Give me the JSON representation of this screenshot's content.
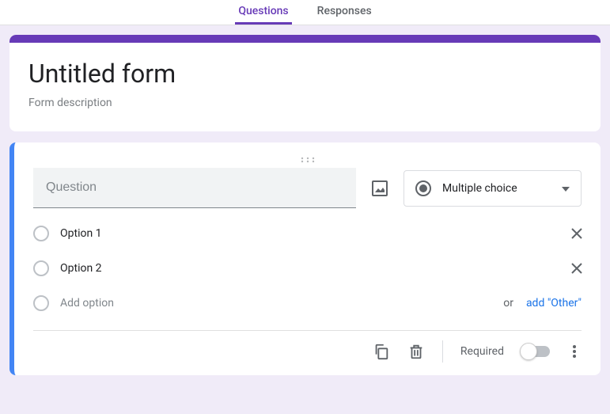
{
  "tabs": {
    "questions": "Questions",
    "responses": "Responses"
  },
  "header": {
    "title": "Untitled form",
    "description": "Form description"
  },
  "question": {
    "placeholder": "Question",
    "type_label": "Multiple choice",
    "options": [
      "Option 1",
      "Option 2"
    ],
    "add_option": "Add option",
    "or": "or",
    "add_other": "add \"Other\""
  },
  "footer": {
    "required": "Required"
  }
}
